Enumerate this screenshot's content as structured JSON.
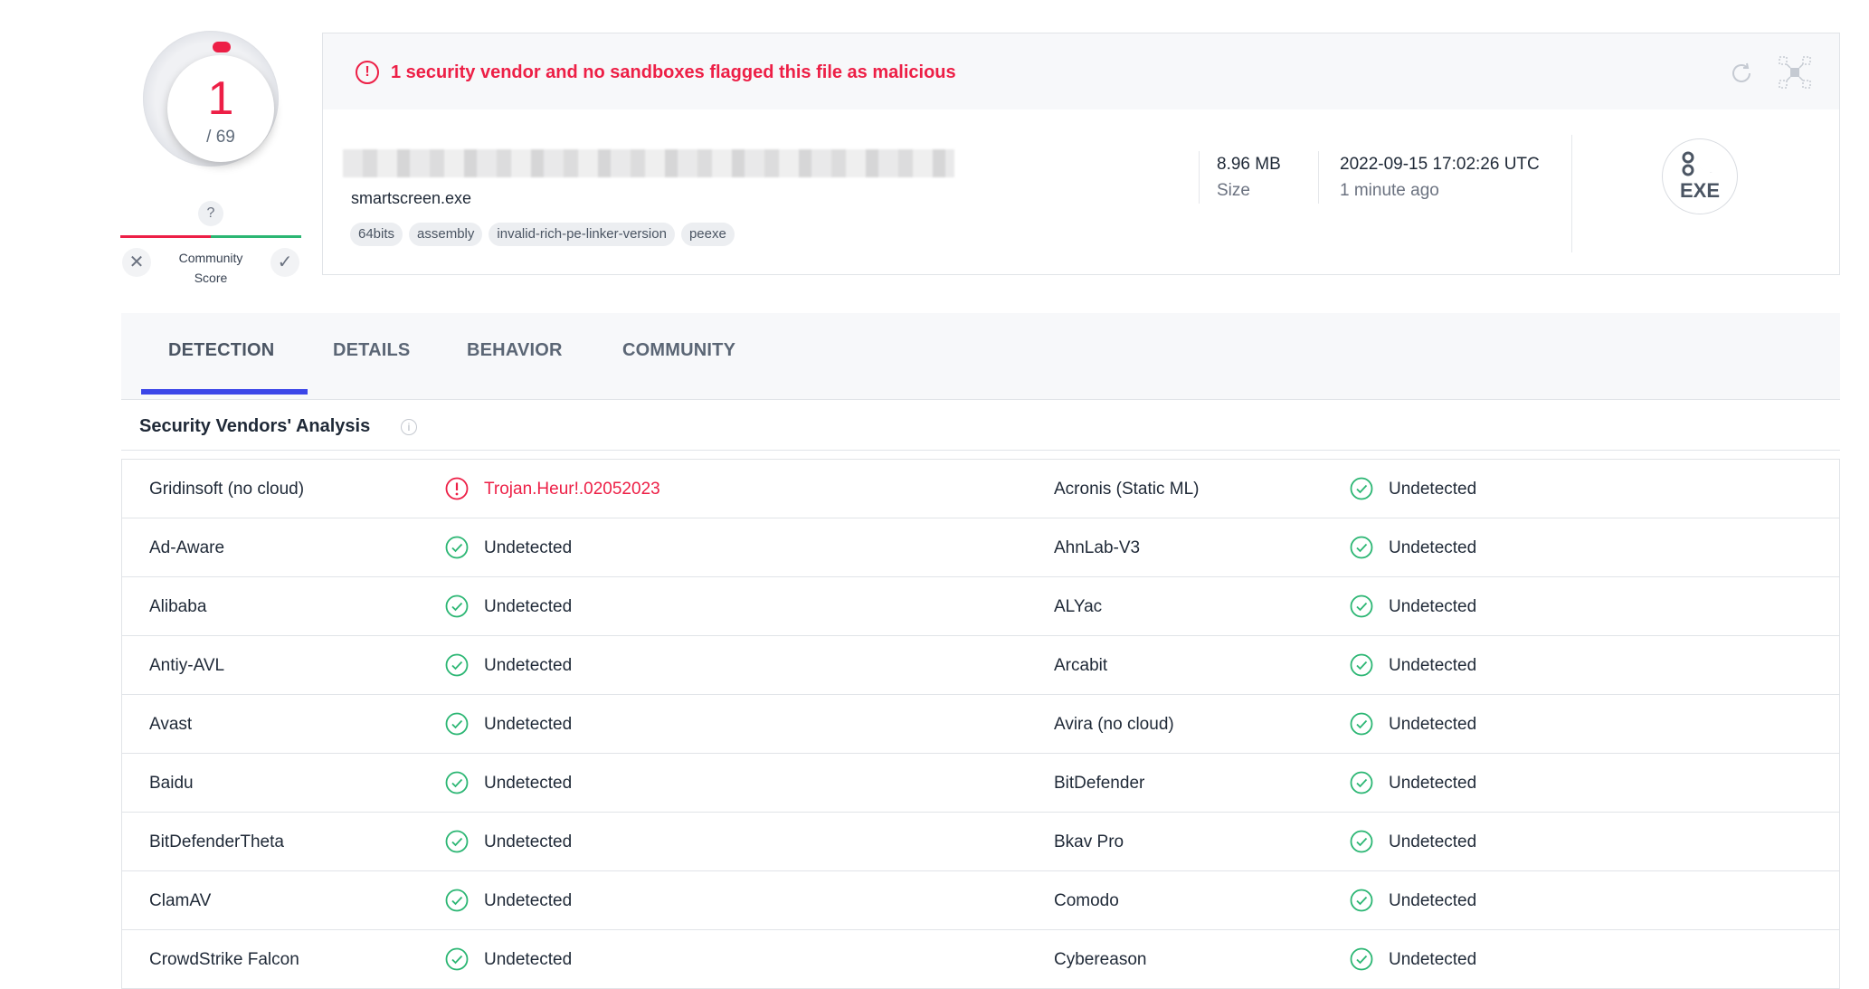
{
  "score": {
    "detections": "1",
    "total": "/ 69"
  },
  "community": {
    "question": "?",
    "label_line1": "Community",
    "label_line2": "Score",
    "x": "✕",
    "check": "✓"
  },
  "alert": {
    "text": "1 security vendor and no sandboxes flagged this file as malicious",
    "icon": "!"
  },
  "file": {
    "name": "smartscreen.exe",
    "tags": [
      "64bits",
      "assembly",
      "invalid-rich-pe-linker-version",
      "peexe"
    ],
    "size_value": "8.96 MB",
    "size_label": "Size",
    "date_value": "2022-09-15 17:02:26 UTC",
    "date_label": "1 minute ago",
    "type_badge": "EXE"
  },
  "tabs": [
    "DETECTION",
    "DETAILS",
    "BEHAVIOR",
    "COMMUNITY"
  ],
  "section": {
    "title": "Security Vendors' Analysis",
    "info": "i"
  },
  "colors": {
    "malicious": "#ed1f46",
    "clean": "#2bb673",
    "accent": "#3b46e8"
  },
  "vendors": [
    {
      "left_name": "Gridinsoft (no cloud)",
      "left_result": "Trojan.Heur!.02052023",
      "left_status": "malicious",
      "right_name": "Acronis (Static ML)",
      "right_result": "Undetected",
      "right_status": "clean"
    },
    {
      "left_name": "Ad-Aware",
      "left_result": "Undetected",
      "left_status": "clean",
      "right_name": "AhnLab-V3",
      "right_result": "Undetected",
      "right_status": "clean"
    },
    {
      "left_name": "Alibaba",
      "left_result": "Undetected",
      "left_status": "clean",
      "right_name": "ALYac",
      "right_result": "Undetected",
      "right_status": "clean"
    },
    {
      "left_name": "Antiy-AVL",
      "left_result": "Undetected",
      "left_status": "clean",
      "right_name": "Arcabit",
      "right_result": "Undetected",
      "right_status": "clean"
    },
    {
      "left_name": "Avast",
      "left_result": "Undetected",
      "left_status": "clean",
      "right_name": "Avira (no cloud)",
      "right_result": "Undetected",
      "right_status": "clean"
    },
    {
      "left_name": "Baidu",
      "left_result": "Undetected",
      "left_status": "clean",
      "right_name": "BitDefender",
      "right_result": "Undetected",
      "right_status": "clean"
    },
    {
      "left_name": "BitDefenderTheta",
      "left_result": "Undetected",
      "left_status": "clean",
      "right_name": "Bkav Pro",
      "right_result": "Undetected",
      "right_status": "clean"
    },
    {
      "left_name": "ClamAV",
      "left_result": "Undetected",
      "left_status": "clean",
      "right_name": "Comodo",
      "right_result": "Undetected",
      "right_status": "clean"
    },
    {
      "left_name": "CrowdStrike Falcon",
      "left_result": "Undetected",
      "left_status": "clean",
      "right_name": "Cybereason",
      "right_result": "Undetected",
      "right_status": "clean"
    }
  ]
}
